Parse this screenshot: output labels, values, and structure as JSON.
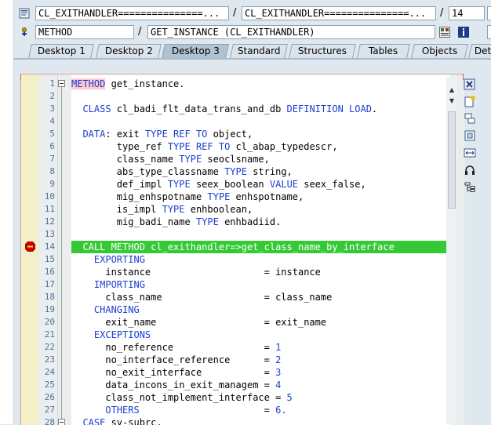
{
  "header": {
    "object_field_1": "CL_EXITHANDLER===============...",
    "separator_1": "/",
    "object_field_2": "CL_EXITHANDLER===============...",
    "separator_2": "/",
    "line_field": "14",
    "type_field": "METHOD",
    "separator_3": "/",
    "method_field": "GET_INSTANCE (CL_EXITHANDLER)"
  },
  "tabs": [
    {
      "label": "Desktop 1"
    },
    {
      "label": "Desktop 2"
    },
    {
      "label": "Desktop 3"
    },
    {
      "label": "Standard"
    },
    {
      "label": "Structures"
    },
    {
      "label": "Tables"
    },
    {
      "label": "Objects"
    },
    {
      "label": "Deta"
    }
  ],
  "active_tab": "Desktop 3",
  "code": {
    "current_line": 14,
    "lines": [
      {
        "n": "1",
        "t": "METHOD get_instance."
      },
      {
        "n": "2",
        "t": ""
      },
      {
        "n": "3",
        "t": "  CLASS cl_badi_flt_data_trans_and_db DEFINITION LOAD."
      },
      {
        "n": "4",
        "t": ""
      },
      {
        "n": "5",
        "t": "  DATA: exit TYPE REF TO object,"
      },
      {
        "n": "6",
        "t": "        type_ref TYPE REF TO cl_abap_typedescr,"
      },
      {
        "n": "7",
        "t": "        class_name TYPE seoclsname,"
      },
      {
        "n": "8",
        "t": "        abs_type_classname TYPE string,"
      },
      {
        "n": "9",
        "t": "        def_impl TYPE seex_boolean VALUE seex_false,"
      },
      {
        "n": "10",
        "t": "        mig_enhspotname TYPE enhspotname,"
      },
      {
        "n": "11",
        "t": "        is_impl TYPE enhboolean,"
      },
      {
        "n": "12",
        "t": "        mig_badi_name TYPE enhbadiid."
      },
      {
        "n": "13",
        "t": ""
      },
      {
        "n": "14",
        "t": "  CALL METHOD cl_exithandler=>get_class_name_by_interface"
      },
      {
        "n": "15",
        "t": "    EXPORTING"
      },
      {
        "n": "16",
        "t": "      instance                    = instance"
      },
      {
        "n": "17",
        "t": "    IMPORTING"
      },
      {
        "n": "18",
        "t": "      class_name                  = class_name"
      },
      {
        "n": "19",
        "t": "    CHANGING"
      },
      {
        "n": "20",
        "t": "      exit_name                   = exit_name"
      },
      {
        "n": "21",
        "t": "    EXCEPTIONS"
      },
      {
        "n": "22",
        "t": "      no_reference                = 1"
      },
      {
        "n": "23",
        "t": "      no_interface_reference      = 2"
      },
      {
        "n": "24",
        "t": "      no_exit_interface           = 3"
      },
      {
        "n": "25",
        "t": "      data_incons_in_exit_managem = 4"
      },
      {
        "n": "26",
        "t": "      class_not_implement_interface = 5"
      },
      {
        "n": "27",
        "t": "      OTHERS                      = 6."
      },
      {
        "n": "28",
        "t": "  CASE sy-subrc."
      }
    ]
  },
  "icons": {
    "breakpoint": "stop-sign-breakpoint-icon",
    "toolbar": [
      "close-icon",
      "new-doc-icon",
      "split-icon",
      "expand-icon",
      "resize-icon",
      "headset-icon",
      "tree-icon"
    ]
  },
  "colors": {
    "current_line_bg": "#35c935",
    "keyword": "#1a3fcf",
    "breakpoint": "#d00000"
  }
}
